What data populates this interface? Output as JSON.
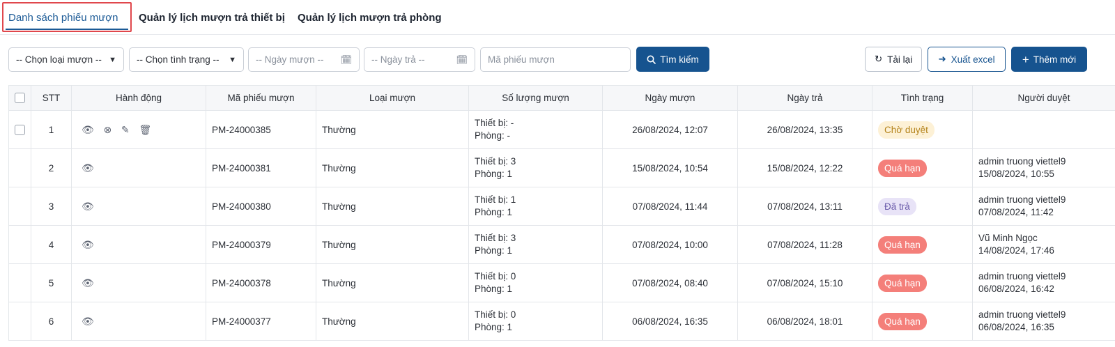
{
  "tabs": [
    {
      "label": "Danh sách phiếu mượn",
      "active": true
    },
    {
      "label": "Quản lý lịch mượn trả thiết bị",
      "active": false
    },
    {
      "label": "Quản lý lịch mượn trả phòng",
      "active": false
    }
  ],
  "filters": {
    "loan_type": "-- Chọn loại mượn --",
    "status": "-- Chọn tình trạng --",
    "borrow_date": "-- Ngày mượn --",
    "return_date": "-- Ngày trả --",
    "code_placeholder": "Mã phiếu mượn",
    "search_label": "Tìm kiếm"
  },
  "toolbar": {
    "reload_label": "Tải lại",
    "export_label": "Xuất excel",
    "add_label": "Thêm mới"
  },
  "table": {
    "headers": [
      "STT",
      "Hành động",
      "Mã phiếu mượn",
      "Loại mượn",
      "Số lượng mượn",
      "Ngày mượn",
      "Ngày trả",
      "Tình trạng",
      "Người duyệt"
    ],
    "rows": [
      {
        "stt": "1",
        "code": "PM-24000385",
        "type": "Thường",
        "devices": "Thiết bị: -",
        "rooms": "Phòng: -",
        "borrow": "26/08/2024, 12:07",
        "return": "26/08/2024, 13:35",
        "status": "Chờ duyệt",
        "approver": "",
        "approved_at": ""
      },
      {
        "stt": "2",
        "code": "PM-24000381",
        "type": "Thường",
        "devices": "Thiết bị: 3",
        "rooms": "Phòng: 1",
        "borrow": "15/08/2024, 10:54",
        "return": "15/08/2024, 12:22",
        "status": "Quá hạn",
        "approver": "admin truong viettel9",
        "approved_at": "15/08/2024, 10:55"
      },
      {
        "stt": "3",
        "code": "PM-24000380",
        "type": "Thường",
        "devices": "Thiết bị: 1",
        "rooms": "Phòng: 1",
        "borrow": "07/08/2024, 11:44",
        "return": "07/08/2024, 13:11",
        "status": "Đã trả",
        "approver": "admin truong viettel9",
        "approved_at": "07/08/2024, 11:42"
      },
      {
        "stt": "4",
        "code": "PM-24000379",
        "type": "Thường",
        "devices": "Thiết bị: 3",
        "rooms": "Phòng: 1",
        "borrow": "07/08/2024, 10:00",
        "return": "07/08/2024, 11:28",
        "status": "Quá hạn",
        "approver": "Vũ Minh Ngọc",
        "approved_at": "14/08/2024, 17:46"
      },
      {
        "stt": "5",
        "code": "PM-24000378",
        "type": "Thường",
        "devices": "Thiết bị: 0",
        "rooms": "Phòng: 1",
        "borrow": "07/08/2024, 08:40",
        "return": "07/08/2024, 15:10",
        "status": "Quá hạn",
        "approver": "admin truong viettel9",
        "approved_at": "06/08/2024, 16:42"
      },
      {
        "stt": "6",
        "code": "PM-24000377",
        "type": "Thường",
        "devices": "Thiết bị: 0",
        "rooms": "Phòng: 1",
        "borrow": "06/08/2024, 16:35",
        "return": "06/08/2024, 18:01",
        "status": "Quá hạn",
        "approver": "admin truong viettel9",
        "approved_at": "06/08/2024, 16:35"
      }
    ]
  },
  "colors": {
    "primary": "#16538f",
    "highlight_border": "#e0474c",
    "badge_pending_bg": "#fdf1d6",
    "badge_overdue_bg": "#f47f7a",
    "badge_returned_bg": "#e8e3f7"
  }
}
